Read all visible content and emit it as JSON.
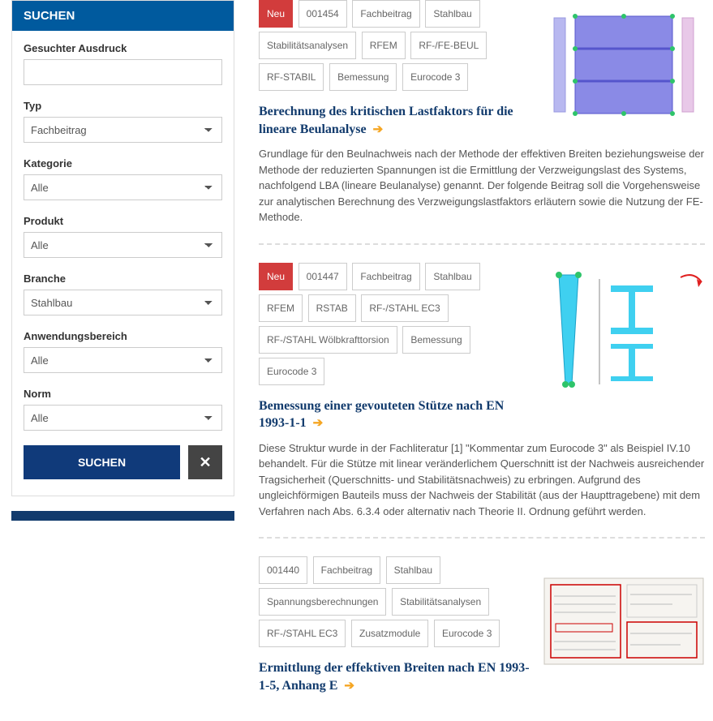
{
  "sidebar": {
    "header": "SUCHEN",
    "fields": {
      "expression_label": "Gesuchter Ausdruck",
      "expression_value": "",
      "type_label": "Typ",
      "type_value": "Fachbeitrag",
      "category_label": "Kategorie",
      "category_value": "Alle",
      "product_label": "Produkt",
      "product_value": "Alle",
      "industry_label": "Branche",
      "industry_value": "Stahlbau",
      "scope_label": "Anwendungsbereich",
      "scope_value": "Alle",
      "norm_label": "Norm",
      "norm_value": "Alle"
    },
    "search_button": "SUCHEN",
    "reset_button": "✕"
  },
  "articles": [
    {
      "tags": [
        "Neu",
        "001454",
        "Fachbeitrag",
        "Stahlbau",
        "Stabilitätsanalysen",
        "RFEM",
        "RF-/FE-BEUL",
        "RF-STABIL",
        "Bemessung",
        "Eurocode 3"
      ],
      "neu": true,
      "title": "Berechnung des kritischen Lastfaktors für die lineare Beulanalyse",
      "desc": "Grundlage für den Beulnachweis nach der Methode der effektiven Breiten beziehungsweise der Methode der reduzierten Spannungen ist die Ermittlung der Verzweigungslast des Systems, nachfolgend LBA (lineare Beulanalyse) genannt. Der folgende Beitrag soll die Vorgehensweise zur analytischen Berechnung des Verzweigungslastfaktors erläutern sowie die Nutzung der FE-Methode."
    },
    {
      "tags": [
        "Neu",
        "001447",
        "Fachbeitrag",
        "Stahlbau",
        "RFEM",
        "RSTAB",
        "RF-/STAHL EC3",
        "RF-/STAHL Wölbkrafttorsion",
        "Bemessung",
        "Eurocode 3"
      ],
      "neu": true,
      "title": "Bemessung einer gevouteten Stütze nach EN 1993-1-1",
      "desc": "Diese Struktur wurde in der Fachliteratur [1] \"Kommentar zum Eurocode 3\" als Beispiel IV.10 behandelt. Für die Stütze mit linear veränderlichem Querschnitt ist der Nachweis ausreichender Tragsicherheit (Querschnitts- und Stabilitätsnachweis) zu erbringen. Aufgrund des ungleichförmigen Bauteils muss der Nachweis der Stabilität (aus der Haupttragebene) mit dem Verfahren nach Abs. 6.3.4 oder alternativ nach Theorie II. Ordnung geführt werden."
    },
    {
      "tags": [
        "001440",
        "Fachbeitrag",
        "Stahlbau",
        "Spannungsberechnungen",
        "Stabilitätsanalysen",
        "RF-/STAHL EC3",
        "Zusatzmodule",
        "Eurocode 3"
      ],
      "neu": false,
      "title": "Ermittlung der effektiven Breiten nach EN 1993-1-5, Anhang E",
      "desc": ""
    }
  ]
}
